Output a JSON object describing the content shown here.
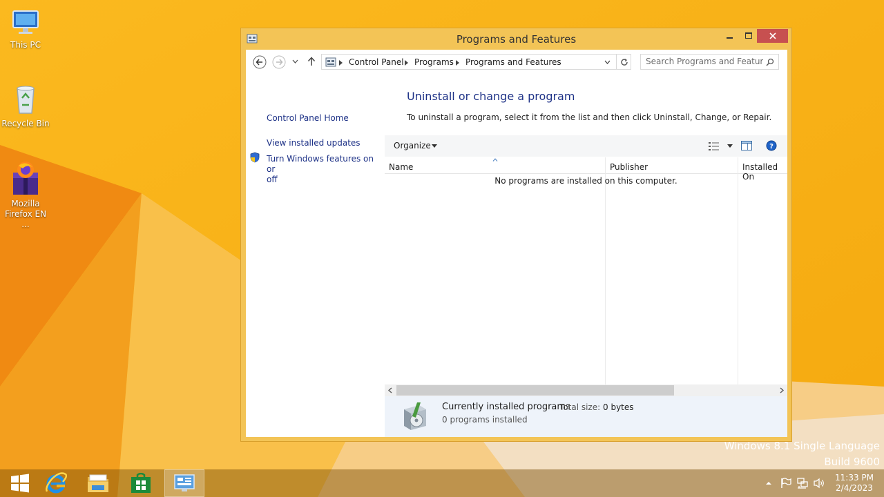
{
  "desktop": {
    "icons": [
      {
        "label": "This PC"
      },
      {
        "label": "Recycle Bin"
      },
      {
        "label_line1": "Mozilla",
        "label_line2": "Firefox EN ..."
      }
    ],
    "watermark": {
      "line1": "Windows 8.1 Single Language",
      "line2": "Build 9600"
    }
  },
  "window": {
    "title": "Programs and Features",
    "breadcrumb": [
      "Control Panel",
      "Programs",
      "Programs and Features"
    ],
    "search_placeholder": "Search Programs and Features",
    "left_pane": {
      "home": "Control Panel Home",
      "updates": "View installed updates",
      "features_line1": "Turn Windows features on or",
      "features_line2": "off"
    },
    "heading": "Uninstall or change a program",
    "instructions": "To uninstall a program, select it from the list and then click Uninstall, Change, or Repair.",
    "organize": "Organize",
    "columns": [
      "Name",
      "Publisher",
      "Installed On"
    ],
    "empty_message": "No programs are installed on this computer.",
    "details": {
      "title": "Currently installed programs",
      "size_label": "Total size:",
      "size_value": "0 bytes",
      "count": "0 programs installed"
    }
  },
  "taskbar": {
    "clock_time": "11:33 PM",
    "clock_date": "2/4/2023"
  },
  "colors": {
    "accent_link": "#1e3287",
    "window_frame": "#f3c456",
    "close_button": "#c75050"
  }
}
